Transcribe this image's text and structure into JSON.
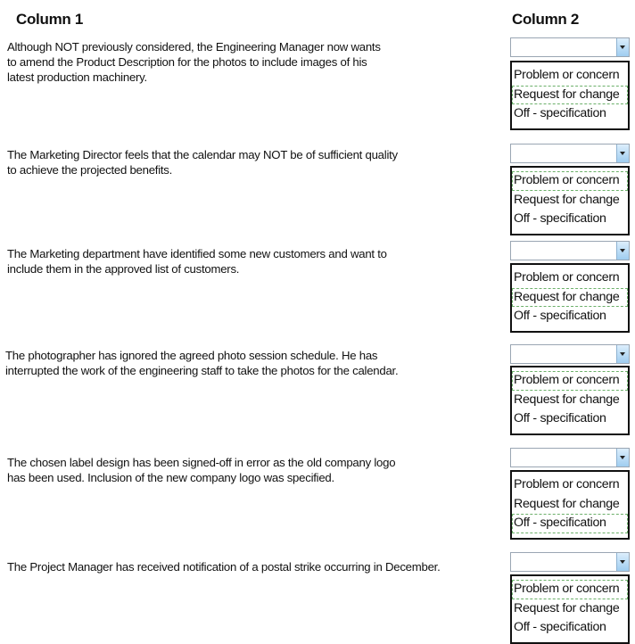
{
  "headers": {
    "column1": "Column 1",
    "column2": "Column 2"
  },
  "options": [
    "Problem or concern",
    "Request for change",
    "Off - specification"
  ],
  "highlight_color": "#6cb06a",
  "rows": [
    {
      "statement_lines": [
        "Although NOT previously considered, the Engineering Manager now wants",
        "to amend the Product Description for the photos to include images of his",
        "latest production machinery."
      ],
      "selected_value": "",
      "highlighted_option": "Request for change"
    },
    {
      "statement_lines": [
        "The Marketing Director feels that the calendar may NOT be of sufficient quality",
        "to achieve the projected benefits."
      ],
      "selected_value": "",
      "highlighted_option": "Problem or concern"
    },
    {
      "statement_lines": [
        "The Marketing department have identified some new customers and want to",
        "include them in the approved list of customers."
      ],
      "selected_value": "",
      "highlighted_option": "Request for change"
    },
    {
      "statement_lines": [
        "The photographer has ignored the agreed photo session schedule. He has",
        "interrupted the work of the engineering staff to take the photos for the calendar."
      ],
      "selected_value": "",
      "highlighted_option": "Problem or concern"
    },
    {
      "statement_lines": [
        "The chosen label design has been signed-off in error as the old company logo",
        "has been used. Inclusion of the new company logo was specified."
      ],
      "selected_value": "",
      "highlighted_option": "Off - specification"
    },
    {
      "statement_lines": [
        "The Project Manager has received notification of a postal strike occurring in December."
      ],
      "selected_value": "",
      "highlighted_option": "Problem or concern"
    }
  ]
}
